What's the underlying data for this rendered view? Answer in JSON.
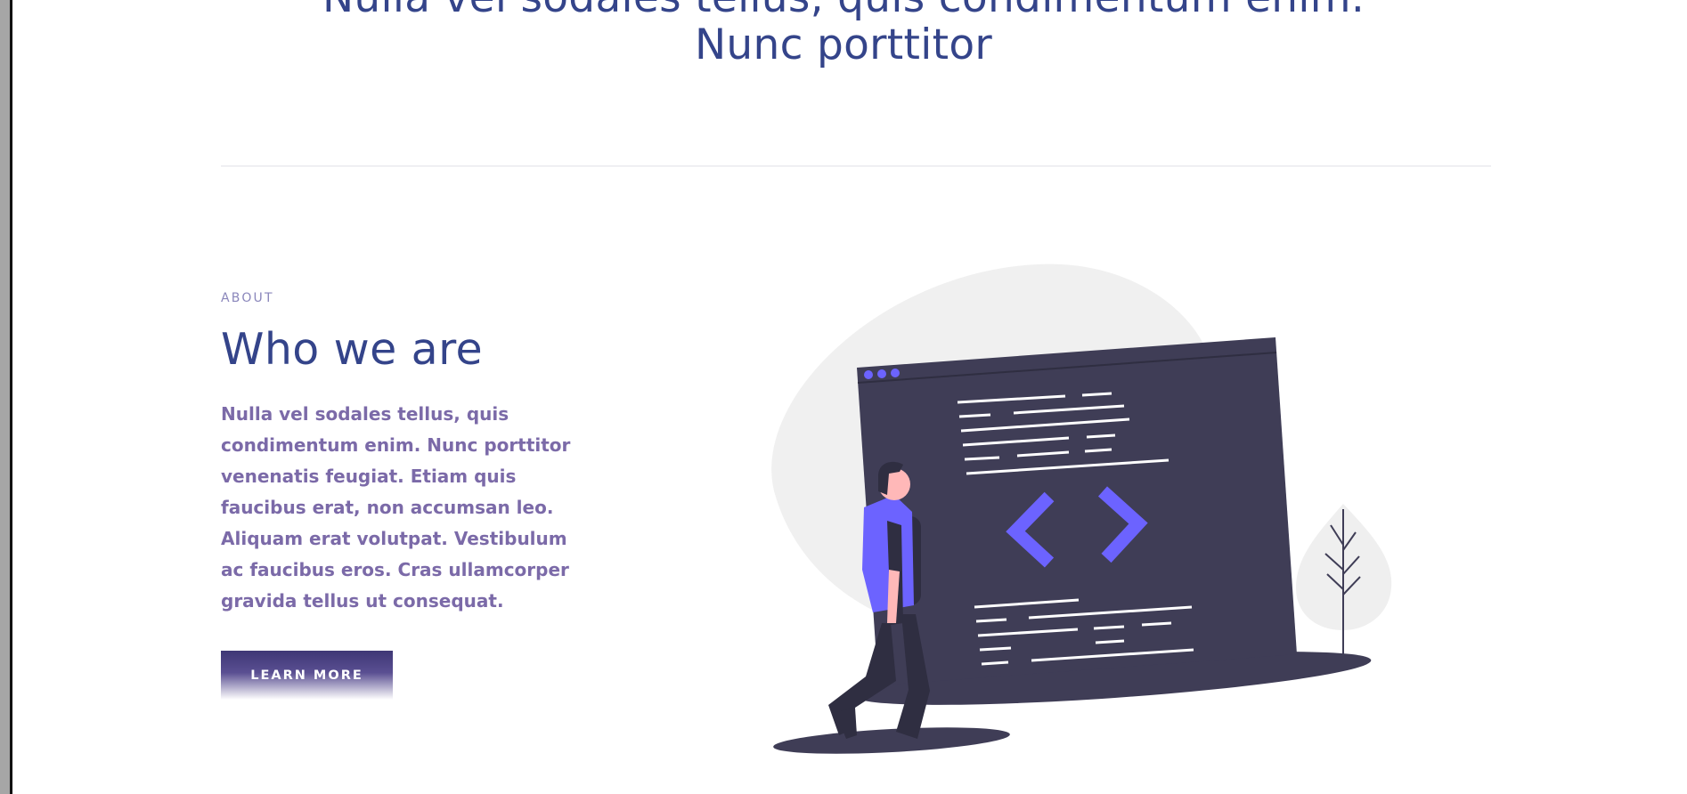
{
  "hero": {
    "line1": "Nulla vel sodales tellus, quis condimentum enim.",
    "line2": "Nunc porttitor"
  },
  "about": {
    "eyebrow": "ABOUT",
    "title": "Who we are",
    "body": "Nulla vel sodales tellus, quis condimentum enim. Nunc porttitor venenatis feugiat. Etiam quis faucibus erat, non accumsan leo. Aliquam erat volutpat. Vestibulum ac faucibus eros. Cras ullamcorper gravida tellus ut consequat.",
    "button_label": "LEARN MORE"
  },
  "colors": {
    "heading": "#34448a",
    "body": "#7b6aa8",
    "accent": "#6c63ff",
    "window": "#3f3d56"
  },
  "illustration": {
    "name": "developer-code-window-illustration"
  }
}
